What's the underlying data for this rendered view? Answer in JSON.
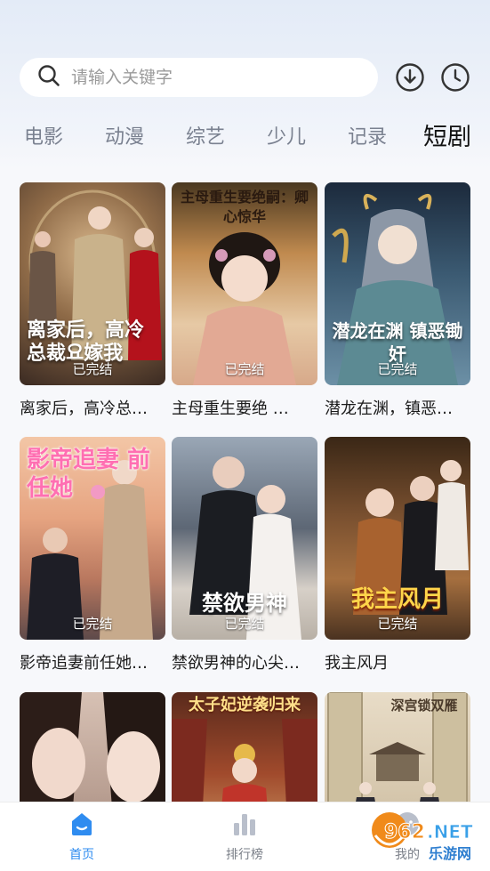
{
  "search": {
    "placeholder": "请输入关键字"
  },
  "header_icons": [
    "download-icon",
    "history-icon"
  ],
  "tabs": [
    {
      "label": "电影"
    },
    {
      "label": "动漫"
    },
    {
      "label": "综艺"
    },
    {
      "label": "少儿"
    },
    {
      "label": "记录"
    },
    {
      "label": "短剧",
      "active": true
    }
  ],
  "cards": [
    {
      "title": "离家后，高冷总…",
      "status": "已完结",
      "poster_text": "离家后，高冷总裁요嫁我"
    },
    {
      "title": "主母重生要绝 …",
      "status": "已完结",
      "poster_text": "主母重生要绝嗣：卿心惊华"
    },
    {
      "title": "潜龙在渊，镇恶…",
      "status": "已完结",
      "poster_text": "潜龙在渊 镇恶锄奸"
    },
    {
      "title": "影帝追妻前任她…",
      "status": "已完结",
      "poster_text": "影帝追妻 前任她"
    },
    {
      "title": "禁欲男神的心尖…",
      "status": "已完结",
      "poster_text": "禁欲男神"
    },
    {
      "title": "我主风月",
      "status": "已完结",
      "poster_text": "我主风月"
    },
    {
      "title": "",
      "status": "",
      "poster_text": ""
    },
    {
      "title": "",
      "status": "",
      "poster_text": "太子妃逆袭归来"
    },
    {
      "title": "",
      "status": "",
      "poster_text": "深宫锁双雁"
    }
  ],
  "nav": [
    {
      "label": "首页",
      "active": true
    },
    {
      "label": "排行榜"
    },
    {
      "label": "我的"
    }
  ],
  "watermark": {
    "text": "962.NET",
    "subtext": "乐游网"
  },
  "colors": {
    "accent": "#2f8cf0",
    "tab_inactive": "#7a8190",
    "text": "#1c1c1c"
  }
}
